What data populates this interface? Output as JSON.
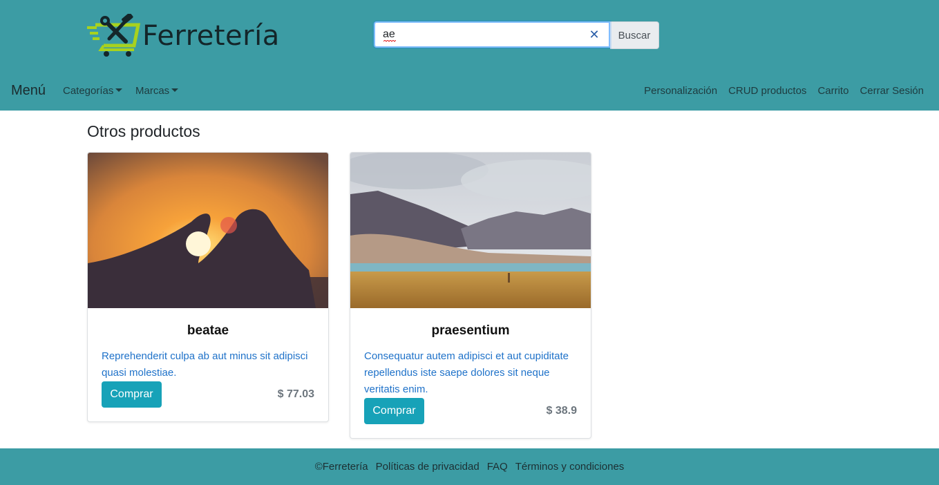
{
  "header": {
    "logo_text": "Ferretería",
    "search": {
      "value": "ae",
      "clear_icon": "close-icon",
      "button_label": "Buscar"
    }
  },
  "nav": {
    "brand": "Menú",
    "dropdowns": [
      {
        "label": "Categorías"
      },
      {
        "label": "Marcas"
      }
    ],
    "right_links": [
      {
        "label": "Personalización"
      },
      {
        "label": "CRUD productos"
      },
      {
        "label": "Carrito"
      },
      {
        "label": "Cerrar Sesión"
      }
    ]
  },
  "main": {
    "section_title": "Otros productos",
    "products": [
      {
        "name": "beatae",
        "description": "Reprehenderit culpa ab aut minus sit adipisci quasi molestiae.",
        "buy_label": "Comprar",
        "price": "$ 77.03",
        "image_icon": "hands-heart-sunset-photo"
      },
      {
        "name": "praesentium",
        "description": "Consequatur autem adipisci et aut cupiditate repellendus iste saepe dolores sit neque veritatis enim.",
        "buy_label": "Comprar",
        "price": "$ 38.9",
        "image_icon": "mountain-lake-photo"
      }
    ]
  },
  "footer": {
    "copyright": "©Ferretería",
    "links": [
      {
        "label": "Políticas de privacidad"
      },
      {
        "label": "FAQ"
      },
      {
        "label": "Términos y condiciones"
      }
    ]
  },
  "colors": {
    "header_bg": "#3c9ca4",
    "button_bg": "#17a2b8",
    "description_text": "#1f72c9",
    "price_text": "#6c757d"
  }
}
